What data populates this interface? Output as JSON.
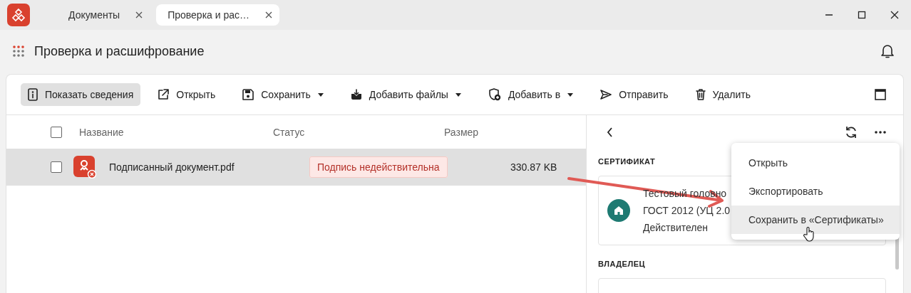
{
  "tabs": [
    {
      "label": "Документы",
      "selected": false
    },
    {
      "label": "Проверка и рас…",
      "selected": true
    }
  ],
  "header": {
    "title": "Проверка и расшифрование"
  },
  "toolbar": [
    {
      "label": "Показать сведения",
      "kind": "info",
      "selected": true,
      "dropdown": false
    },
    {
      "label": "Открыть",
      "kind": "open",
      "selected": false,
      "dropdown": false
    },
    {
      "label": "Сохранить",
      "kind": "save",
      "selected": false,
      "dropdown": true
    },
    {
      "label": "Добавить файлы",
      "kind": "add-files",
      "selected": false,
      "dropdown": true
    },
    {
      "label": "Добавить в",
      "kind": "shield",
      "selected": false,
      "dropdown": true
    },
    {
      "label": "Отправить",
      "kind": "send",
      "selected": false,
      "dropdown": false
    },
    {
      "label": "Удалить",
      "kind": "delete",
      "selected": false,
      "dropdown": false
    }
  ],
  "file_list": {
    "columns": [
      "Название",
      "Статус",
      "Размер"
    ],
    "all_checked": false,
    "rows": [
      {
        "name": "Подписанный документ.pdf",
        "status": "Подпись недействительна",
        "size": "330.87 KB",
        "checked": false,
        "selected": true
      }
    ]
  },
  "details": {
    "sections": [
      {
        "title": "СЕРТИФИКАТ",
        "lines": [
          "Тестовый головно",
          "ГОСТ 2012 (УЦ 2.0",
          "Действителен"
        ]
      },
      {
        "title": "ВЛАДЕЛЕЦ"
      }
    ]
  },
  "context_menu": {
    "items": [
      {
        "label": "Открыть",
        "selected": false
      },
      {
        "label": "Экспортировать",
        "selected": false
      },
      {
        "label": "Сохранить в «Сертификаты»",
        "selected": true
      }
    ]
  }
}
